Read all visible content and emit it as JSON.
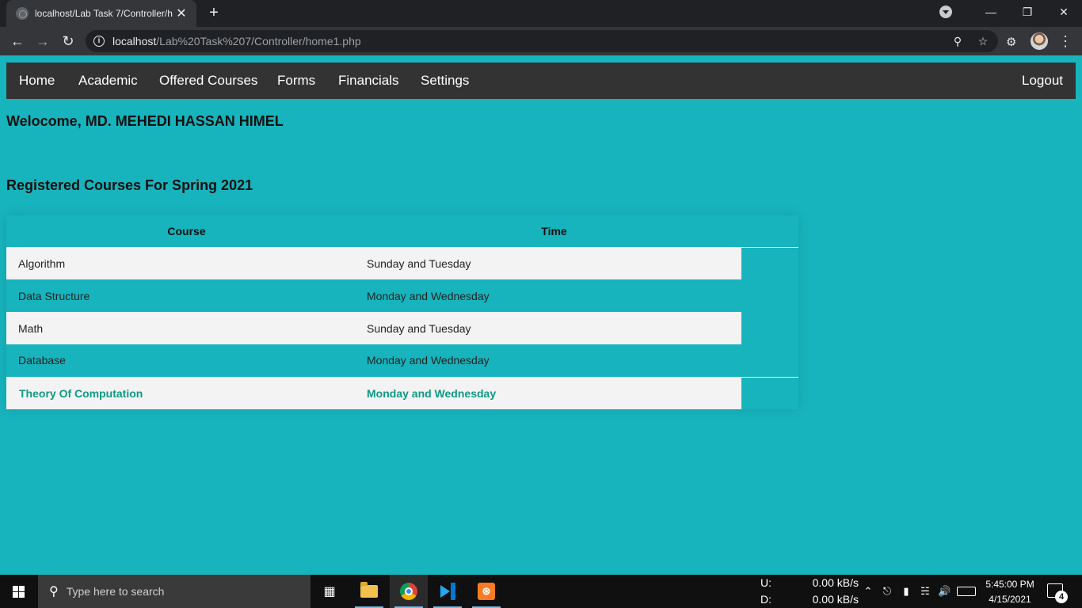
{
  "browser": {
    "tab_title": "localhost/Lab Task 7/Controller/h",
    "tab_close": "✕",
    "new_tab": "+",
    "url_host": "localhost",
    "url_path": "/Lab%20Task%207/Controller/home1.php",
    "window_controls": {
      "minimize": "—",
      "restore": "❐",
      "close": "✕"
    },
    "icons": [
      "back-arrow-icon",
      "forward-arrow-icon",
      "reload-icon",
      "info-icon",
      "key-icon",
      "star-icon",
      "puzzle-icon",
      "avatar",
      "more-vert-icon"
    ]
  },
  "nav": {
    "items": [
      {
        "label": "Home"
      },
      {
        "label": "Academic"
      },
      {
        "label": "Offered Courses"
      },
      {
        "label": "Forms"
      },
      {
        "label": "Financials"
      },
      {
        "label": "Settings"
      }
    ],
    "logout": "Logout"
  },
  "welcome": "Welocome, MD. MEHEDI HASSAN HIMEL",
  "section_title": "Registered Courses For Spring 2021",
  "table": {
    "headers": [
      "Course",
      "Time"
    ],
    "rows": [
      {
        "course": "Algorithm",
        "time": "Sunday and Tuesday"
      },
      {
        "course": "Data Structure",
        "time": "Monday and Wednesday"
      },
      {
        "course": "Math",
        "time": "Sunday and Tuesday"
      },
      {
        "course": "Database",
        "time": "Monday and Wednesday"
      },
      {
        "course": "Theory Of Computation",
        "time": "Monday and Wednesday"
      }
    ]
  },
  "colors": {
    "page_bg": "#17b4bd",
    "nav_bg": "#333333",
    "row_light": "#f3f3f3",
    "active_text": "#0d9a84"
  },
  "taskbar": {
    "search_placeholder": "Type here to search",
    "apps": [
      "task-view-icon",
      "file-explorer-icon",
      "chrome-icon",
      "vscode-icon",
      "xampp-icon"
    ],
    "net_up_label": "U:",
    "net_up_value": "0.00 kB/s",
    "net_down_label": "D:",
    "net_down_value": "0.00 kB/s",
    "time": "5:45:00 PM",
    "date": "4/15/2021",
    "notification_count": "4"
  }
}
